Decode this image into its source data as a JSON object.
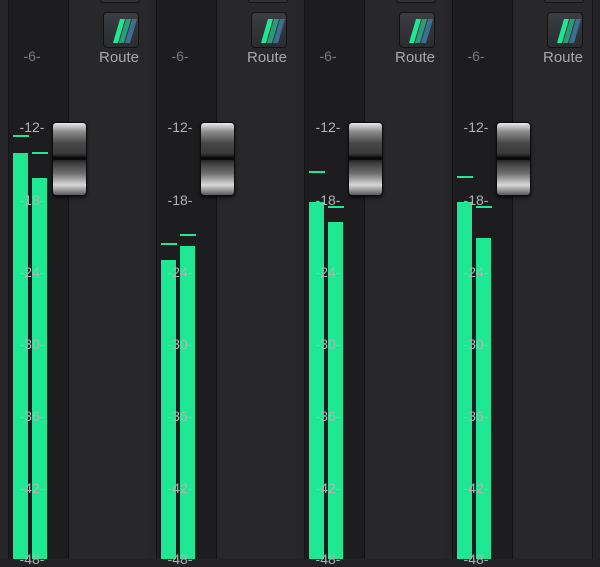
{
  "route_label": "Route",
  "scale_labels": [
    "-6-",
    "-12-",
    "-18-",
    "-24-",
    "-30-",
    "-36-",
    "-42-",
    "-48-"
  ],
  "channels": [
    {
      "route": "Route",
      "meter_left_db": -14.1,
      "meter_right_db": -16.2,
      "peak_left_db": -12.6,
      "peak_right_db": -14.0
    },
    {
      "route": "Route",
      "meter_left_db": -23.0,
      "meter_right_db": -21.8,
      "peak_left_db": -21.6,
      "peak_right_db": -20.8
    },
    {
      "route": "Route",
      "meter_left_db": -18.2,
      "meter_right_db": -19.8,
      "peak_left_db": -15.6,
      "peak_right_db": -18.5
    },
    {
      "route": "Route",
      "meter_left_db": -18.2,
      "meter_right_db": -21.2,
      "peak_left_db": -16.0,
      "peak_right_db": -18.5
    }
  ],
  "colors": {
    "meter_green": "#1ee893",
    "background": "#232325",
    "label_text": "#b2b2b4",
    "route_icon_stripe_1": "#1ee893",
    "route_icon_stripe_2": "#2b9c7a",
    "route_icon_stripe_3": "#3b6f93"
  },
  "icons": {
    "route_button": "route-stripes-icon",
    "fader": "fader-knob-icon"
  }
}
